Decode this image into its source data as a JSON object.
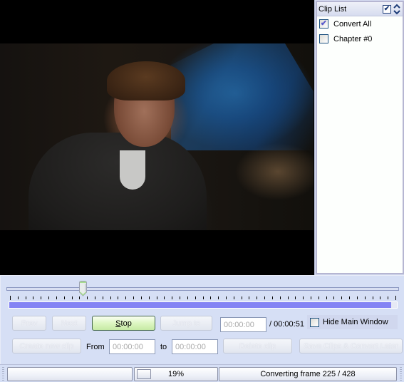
{
  "video": {
    "description": "interview video frame"
  },
  "clip_list": {
    "title": "Clip List",
    "header_check_icon": "checkmark-icon",
    "header_sort_icon": "up-down-chevron-icon",
    "items": [
      {
        "label": "Convert All",
        "checked": true
      },
      {
        "label": "Chapter #0",
        "checked": false
      }
    ]
  },
  "timeline": {
    "position_fraction": 0.19,
    "tick_count": 51,
    "progress_percent": 100
  },
  "controls": {
    "prev_label": "Prev",
    "next_label": "Next",
    "stop_label": "Stop",
    "stop_mnemonic": "S",
    "stop_rest": "top",
    "jump_label": "Jump to",
    "current_time": "00:00:00",
    "total_time": "/ 00:00:51",
    "hide_main_label": "Hide Main Window",
    "hide_main_checked": false,
    "create_clip_label": "Create new clip",
    "from_label": "From",
    "from_value": "00:00:00",
    "to_label": "to",
    "to_value": "00:00:00",
    "delete_clip_label": "Delete clip",
    "save_later_label": "Save Clips & Convert Later"
  },
  "status": {
    "percent": "19%",
    "percent_value": 19,
    "message": "Converting frame 225 / 428"
  }
}
